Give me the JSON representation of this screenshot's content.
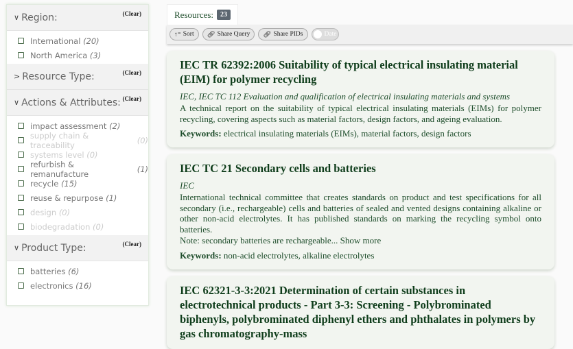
{
  "filters": [
    {
      "title": "Region:",
      "expanded": true,
      "clear": "(Clear)",
      "options": [
        {
          "label": "International",
          "count": "(20)",
          "enabled": true
        },
        {
          "label": "North America",
          "count": "(3)",
          "enabled": true
        }
      ]
    },
    {
      "title": "Resource Type:",
      "expanded": false,
      "clear": "(Clear)",
      "options": []
    },
    {
      "title": "Actions & Attributes:",
      "expanded": true,
      "clear": "(Clear)",
      "options": [
        {
          "label": "impact assessment",
          "count": "(2)",
          "enabled": true
        },
        {
          "label": "supply chain & traceability",
          "count": "(0)",
          "enabled": false
        },
        {
          "label": "systems level",
          "count": "(0)",
          "enabled": false
        },
        {
          "label": "refurbish & remanufacture",
          "count": "(1)",
          "enabled": true
        },
        {
          "label": "recycle",
          "count": "(15)",
          "enabled": true
        },
        {
          "label": "reuse & repurpose",
          "count": "(1)",
          "enabled": true
        },
        {
          "label": "design",
          "count": "(0)",
          "enabled": false
        },
        {
          "label": "biodegradation",
          "count": "(0)",
          "enabled": false
        }
      ]
    },
    {
      "title": "Product Type:",
      "expanded": true,
      "clear": "(Clear)",
      "options": [
        {
          "label": "batteries",
          "count": "(6)",
          "enabled": true
        },
        {
          "label": "electronics",
          "count": "(16)",
          "enabled": true
        }
      ]
    }
  ],
  "tab": {
    "label": "Resources:",
    "count": "23"
  },
  "toolbar": {
    "sort": "Sort",
    "share_query": "Share Query",
    "share_pids": "Share PIDs",
    "date_toggle": "Date"
  },
  "results": [
    {
      "title": "IEC TR 62392:2006 Suitability of typical electrical insulating material (EIM) for polymer recycling",
      "source": "IEC, IEC TC 112 Evaluation and qualification of electrical insulating materials and systems",
      "description": "A technical report on the suitability of typical electrical insulating materials (EIMs) for polymer recycling, covering aspects such as material factors, design factors, and ageing evaluation.",
      "keywords_label": "Keywords:",
      "keywords": "electrical insulating materials (EIMs), material factors, design factors"
    },
    {
      "title": "IEC TC 21 Secondary cells and batteries",
      "source": "IEC",
      "description": "International technical committee that creates standards on product and test specifications for all secondary (i.e., rechargeable) cells and batteries of sealed and vented designs containing alkaline or other non-acid electrolytes. It has published standards on marking the recycling symbol onto batteries.",
      "note": "Note: secondary batteries are rechargeable... Show more",
      "keywords_label": "Keywords:",
      "keywords": "non-acid electrolytes, alkaline electrolytes"
    },
    {
      "title": "IEC 62321-3-3:2021 Determination of certain substances in electrotechnical products - Part 3-3: Screening - Polybrominated biphenyls, polybrominated diphenyl ethers and phthalates in polymers by gas chromatography-mass"
    }
  ]
}
